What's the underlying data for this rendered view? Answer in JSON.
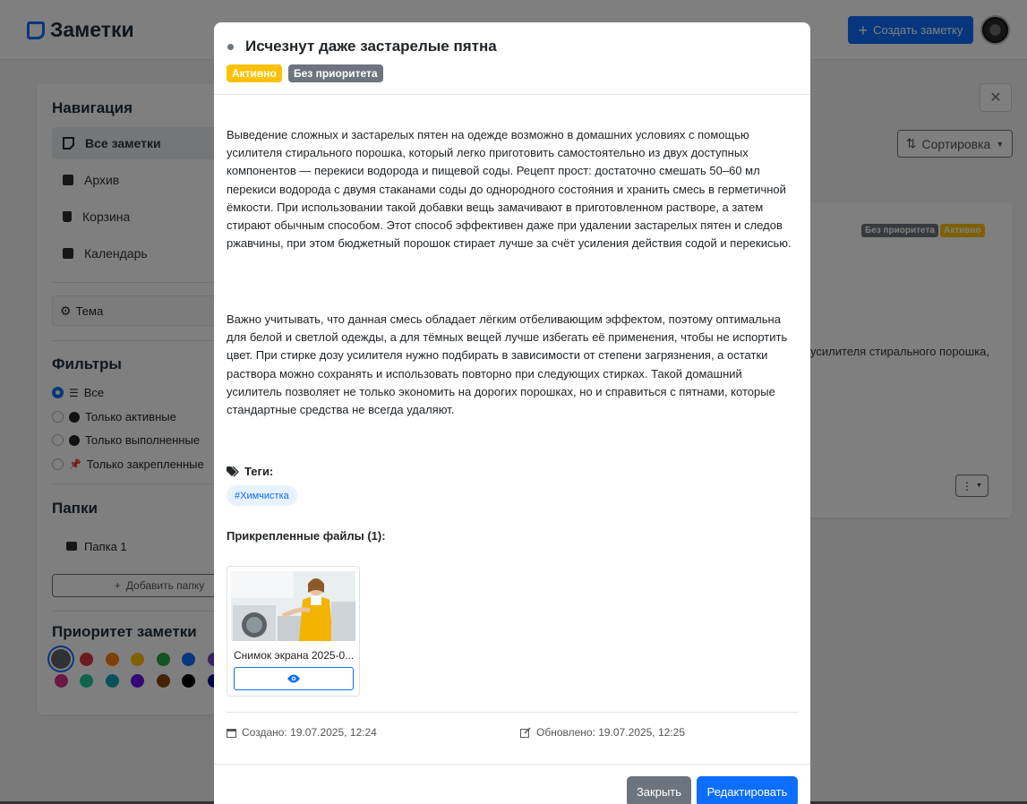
{
  "app": {
    "title": "Заметки",
    "create_label": "Создать заметку"
  },
  "sidebar": {
    "nav_heading": "Навигация",
    "nav_items": [
      {
        "label": "Все заметки",
        "icon": "note-icon"
      },
      {
        "label": "Архив",
        "icon": "archive-icon"
      },
      {
        "label": "Корзина",
        "icon": "trash-icon"
      },
      {
        "label": "Календарь",
        "icon": "calendar-icon"
      }
    ],
    "theme_label": "Тема",
    "filters_heading": "Фильтры",
    "filters": [
      {
        "label": "Все",
        "selected": true
      },
      {
        "label": "Только активные",
        "selected": false
      },
      {
        "label": "Только выполненные",
        "selected": false
      },
      {
        "label": "Только закрепленные",
        "selected": false
      }
    ],
    "folders_heading": "Папки",
    "folders": [
      {
        "label": "Папка 1"
      }
    ],
    "add_folder_label": "Добавить папку",
    "priority_heading": "Приоритет заметки",
    "priority_colors": [
      "#5f6368",
      "#dc3545",
      "#fd7e14",
      "#ffc107",
      "#28a745",
      "#0d6efd",
      "#6f42c1",
      "#d63384",
      "#20c997",
      "#17a2b8",
      "#6610f2",
      "#8b4513",
      "#000000",
      "#00008b"
    ]
  },
  "toolbar": {
    "search_clear_icon": "close-icon",
    "sort_label": "Сортировка"
  },
  "background_card": {
    "priority_badge": "Без приоритета",
    "status_badge": "Активно",
    "snippet": "усилителя стирального порошка,"
  },
  "modal": {
    "title": "Исчезнут даже застарелые пятна",
    "status_badge": "Активно",
    "priority_badge": "Без приоритета",
    "paragraphs": [
      "Выведение сложных и застарелых пятен на одежде возможно в домашних условиях с помощью усилителя стирального порошка, который легко приготовить самостоятельно из двух доступных компонентов — перекиси водорода и пищевой соды. Рецепт прост: достаточно смешать 50–60 мл перекиси водорода с двумя стаканами соды до однородного состояния и хранить смесь в герметичной ёмкости. При использовании такой добавки вещь замачивают в приготовленном растворе, а затем стирают обычным способом. Этот способ эффективен даже при удалении застарелых пятен и следов ржавчины, при этом бюджетный порошок стирает лучше за счёт усиления действия содой и перекисью.",
      "Важно учитывать, что данная смесь обладает лёгким отбеливающим эффектом, поэтому оптимальна для белой и светлой одежды, а для тёмных вещей лучше избегать её применения, чтобы не испортить цвет. При стирке дозу усилителя нужно подбирать в зависимости от степени загрязнения, а остатки раствора можно сохранять и использовать повторно при следующих стирках. Такой домашний усилитель позволяет не только экономить на дорогих порошках, но и справиться с пятнами, которые стандартные средства не всегда удаляют."
    ],
    "tags_label": "Теги:",
    "tags": [
      "#Химчистка"
    ],
    "files_label": "Прикрепленные файлы (1):",
    "files": [
      {
        "name": "Снимок экрана 2025-0..."
      }
    ],
    "created": "Создано: 19.07.2025, 12:24",
    "updated": "Обновлено: 19.07.2025, 12:25",
    "close_label": "Закрыть",
    "edit_label": "Редактировать"
  },
  "colors": {
    "primary": "#0d6efd",
    "warning": "#ffc107",
    "secondary": "#6c757d"
  }
}
